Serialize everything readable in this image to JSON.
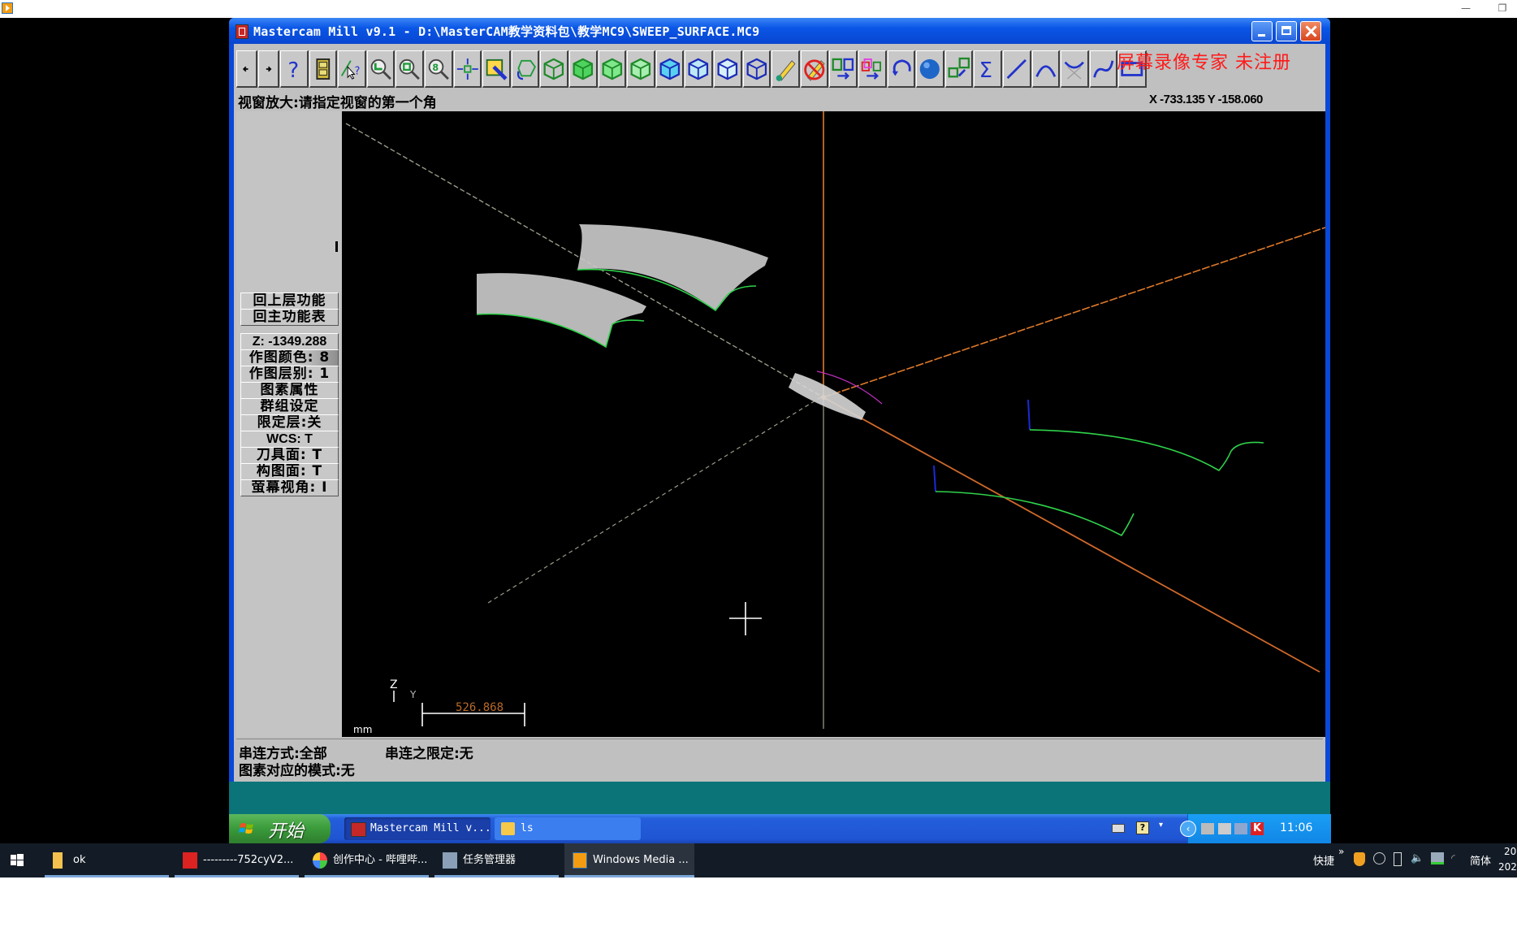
{
  "host_window": {
    "minimize_glyph": "—",
    "restore_glyph": "❐"
  },
  "mastercam": {
    "title": "Mastercam Mill v9.1 - D:\\MasterCAM教学资料包\\教学MC9\\SWEEP_SURFACE.MC9",
    "toolbar": [
      {
        "name": "back-arrow-icon",
        "tooltip": "上一页"
      },
      {
        "name": "forward-arrow-icon",
        "tooltip": "下一页"
      },
      {
        "name": "help-icon",
        "tooltip": "帮助"
      },
      {
        "name": "file-cabinet-icon",
        "tooltip": "文件"
      },
      {
        "name": "analyze-icon",
        "tooltip": "分析"
      },
      {
        "name": "zoom-window-icon",
        "tooltip": "视窗放大"
      },
      {
        "name": "zoom-out-icon",
        "tooltip": "缩小"
      },
      {
        "name": "zoom-fit-icon",
        "tooltip": "适度化"
      },
      {
        "name": "pan-icon",
        "tooltip": "平移"
      },
      {
        "name": "repaint-icon",
        "tooltip": "重画"
      },
      {
        "name": "rotate-view-icon",
        "tooltip": "动态旋转"
      },
      {
        "name": "iso-view-icon",
        "tooltip": "等角视图"
      },
      {
        "name": "front-view-green-icon",
        "tooltip": "前视图"
      },
      {
        "name": "side-view-green-icon",
        "tooltip": "侧视图"
      },
      {
        "name": "top-view-green-icon",
        "tooltip": "俯视图"
      },
      {
        "name": "top-plane-icon",
        "tooltip": "构图面-俯视"
      },
      {
        "name": "front-plane-icon",
        "tooltip": "构图面-前视"
      },
      {
        "name": "side-plane-icon",
        "tooltip": "构图面-侧视"
      },
      {
        "name": "3d-plane-icon",
        "tooltip": "3D"
      },
      {
        "name": "pencil-icon",
        "tooltip": "绘图"
      },
      {
        "name": "no-pencil-icon",
        "tooltip": "取消绘图"
      },
      {
        "name": "translate-icon",
        "tooltip": "平移"
      },
      {
        "name": "mirror-copy-icon",
        "tooltip": "镜像"
      },
      {
        "name": "undo-icon",
        "tooltip": "回复"
      },
      {
        "name": "shade-sphere-icon",
        "tooltip": "着色"
      },
      {
        "name": "scale-copy-icon",
        "tooltip": "比例缩放"
      },
      {
        "name": "sigma-icon",
        "tooltip": "汇总"
      },
      {
        "name": "line-icon",
        "tooltip": "直线"
      },
      {
        "name": "arc-icon",
        "tooltip": "圆弧"
      },
      {
        "name": "fillet-icon",
        "tooltip": "倒圆角"
      },
      {
        "name": "spline-icon",
        "tooltip": "曲线"
      },
      {
        "name": "rectangle-icon",
        "tooltip": "矩形"
      }
    ],
    "watermark": "屏幕录像专家 未注册",
    "prompt": "视窗放大:请指定视窗的第一个角",
    "coordinates": "X -733.135  Y -158.060",
    "menu": [
      {
        "label": "回上层功能",
        "id": "back-to-parent"
      },
      {
        "label": "回主功能表",
        "id": "back-to-main-menu"
      },
      {
        "label": "Z: -1349.288",
        "id": "z-depth"
      },
      {
        "label": "作图颜色: 8",
        "id": "draw-color"
      },
      {
        "label": "作图层别: 1",
        "id": "draw-level"
      },
      {
        "label": "图素属性",
        "id": "entity-attributes"
      },
      {
        "label": "群组设定",
        "id": "group-settings"
      },
      {
        "label": "限定层:关",
        "id": "mask-level"
      },
      {
        "label": "WCS:  T",
        "id": "wcs"
      },
      {
        "label": "刀具面: T",
        "id": "tool-plane"
      },
      {
        "label": "构图面: T",
        "id": "construction-plane"
      },
      {
        "label": "萤幕视角: I",
        "id": "graphics-view"
      }
    ],
    "viewport": {
      "axis_labels": {
        "z": "Z",
        "y": "Y"
      },
      "scale_value": "526.868",
      "units": "mm",
      "colors": {
        "axis": "#e07a2a",
        "curve": "#2fd24a",
        "surface": "#c8c8c8",
        "dashed_line": "#9a9a8a",
        "magenta_arc": "#c030c0",
        "blue_stub": "#1a2ad8"
      }
    },
    "status": {
      "chain_mode": "串连方式:全部",
      "chain_limit": "串连之限定:无",
      "entity_mode": "图素对应的模式:无"
    }
  },
  "xp_taskbar": {
    "start_label": "开始",
    "tasks": [
      {
        "label": "Mastercam Mill v...",
        "active": true
      },
      {
        "label": "ls",
        "active": false
      }
    ],
    "clock": "11:06"
  },
  "win_taskbar": {
    "tasks": [
      {
        "label": "ok"
      },
      {
        "label": "---------752cyV2..."
      },
      {
        "label": "创作中心 - 哔哩哔..."
      },
      {
        "label": "任务管理器"
      },
      {
        "label": "Windows Media ..."
      }
    ],
    "tray": {
      "quick_label": "快捷",
      "overflow": "»",
      "ime": "简体",
      "time_partial": "20",
      "date_partial": "202"
    }
  }
}
